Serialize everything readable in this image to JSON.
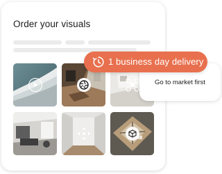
{
  "card": {
    "title": "Order your visuals"
  },
  "delivery_pill": {
    "label": "1 business day delivery",
    "icon": "clock-icon",
    "color": "#e8704e"
  },
  "side_card": {
    "label": "Go to market first"
  },
  "thumbnails": [
    {
      "name": "video",
      "icon": "play-icon"
    },
    {
      "name": "photo",
      "icon": "camera-shutter-icon"
    },
    {
      "name": "drone",
      "icon": "drone-icon"
    },
    {
      "name": "interior"
    },
    {
      "name": "virtual-tour",
      "icon": "move-arrows-icon"
    },
    {
      "name": "3d-floorplan",
      "icon": "cube-icon"
    }
  ]
}
